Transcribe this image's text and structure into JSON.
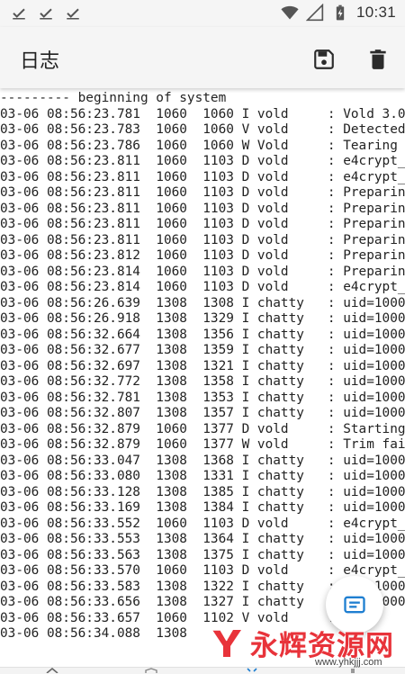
{
  "status_bar": {
    "time": "10:31",
    "notification_icons": [
      "check-icon",
      "check-icon",
      "check-icon"
    ],
    "system_icons": [
      "wifi-icon",
      "signal-icon",
      "battery-icon"
    ]
  },
  "app_bar": {
    "title": "日志",
    "actions": [
      "save-icon",
      "delete-icon"
    ]
  },
  "log": {
    "lines": [
      "--------- beginning of system",
      "03-06 08:56:23.781  1060  1060 I vold     : Vold 3.0",
      "03-06 08:56:23.783  1060  1060 V vold     : Detected",
      "03-06 08:56:23.786  1060  1060 W Vold     : Tearing d",
      "03-06 08:56:23.811  1060  1103 D vold     : e4crypt_i",
      "03-06 08:56:23.811  1060  1103 D vold     : e4crypt_p",
      "03-06 08:56:23.811  1060  1103 D vold     : Preparing",
      "03-06 08:56:23.811  1060  1103 D vold     : Preparing",
      "03-06 08:56:23.811  1060  1103 D vold     : Preparing",
      "03-06 08:56:23.811  1060  1103 D vold     : Preparing",
      "03-06 08:56:23.812  1060  1103 D vold     : Preparing",
      "03-06 08:56:23.814  1060  1103 D vold     : Preparing",
      "03-06 08:56:23.814  1060  1103 D vold     : e4crypt_u",
      "03-06 08:56:26.639  1308  1308 I chatty   : uid=1000",
      "03-06 08:56:26.918  1308  1329 I chatty   : uid=1000(",
      "03-06 08:56:32.664  1308  1356 I chatty   : uid=1000(",
      "03-06 08:56:32.677  1308  1359 I chatty   : uid=1000(",
      "03-06 08:56:32.697  1308  1321 I chatty   : uid=1000(",
      "03-06 08:56:32.772  1308  1358 I chatty   : uid=1000(",
      "03-06 08:56:32.781  1308  1353 I chatty   : uid=1000(",
      "03-06 08:56:32.807  1308  1357 I chatty   : uid=1000(",
      "03-06 08:56:32.879  1060  1377 D vold     : Starting",
      "03-06 08:56:32.879  1060  1377 W vold     : Trim fail",
      "03-06 08:56:33.047  1308  1368 I chatty   : uid=1000(",
      "03-06 08:56:33.080  1308  1331 I chatty   : uid=1000(",
      "03-06 08:56:33.128  1308  1385 I chatty   : uid=1000",
      "03-06 08:56:33.169  1308  1384 I chatty   : uid=1000",
      "03-06 08:56:33.552  1060  1103 D vold     : e4crypt_u",
      "03-06 08:56:33.553  1308  1364 I chatty   : uid=1000(",
      "03-06 08:56:33.563  1308  1375 I chatty   : uid=1000(",
      "03-06 08:56:33.570  1060  1103 D vold     : e4crypt_u",
      "03-06 08:56:33.583  1308  1322 I chatty   : uid=1000(",
      "03-06 08:56:33.656  1308  1327 I chatty   : uid=1000(",
      "03-06 08:56:33.657  1060  1102 V vold     : ",
      "03-06 08:56:34.088  1308"
    ]
  },
  "fab": {
    "icon": "document-icon"
  },
  "watermark": {
    "text": "永辉资源网",
    "url": "www.yhkjjj.com"
  },
  "colors": {
    "accent": "#1f7fd1",
    "bar_bg": "#f5f5f5",
    "watermark": "#e8333a"
  }
}
